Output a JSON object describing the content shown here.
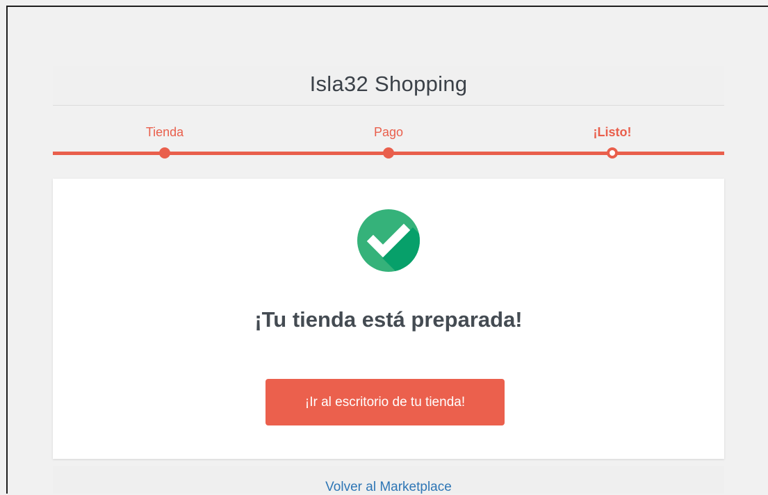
{
  "header": {
    "title": "Isla32 Shopping"
  },
  "steps": [
    {
      "label": "Tienda",
      "state": "done"
    },
    {
      "label": "Pago",
      "state": "done"
    },
    {
      "label": "¡Listo!",
      "state": "current"
    }
  ],
  "main": {
    "icon": "check-circle-icon",
    "heading": "¡Tu tienda está preparada!",
    "button_label": "¡Ir al escritorio de tu tienda!"
  },
  "footer": {
    "link_label": "Volver al Marketplace"
  },
  "colors": {
    "accent": "#e95f4c",
    "success": "#2fb47a",
    "link": "#2e76b5"
  }
}
